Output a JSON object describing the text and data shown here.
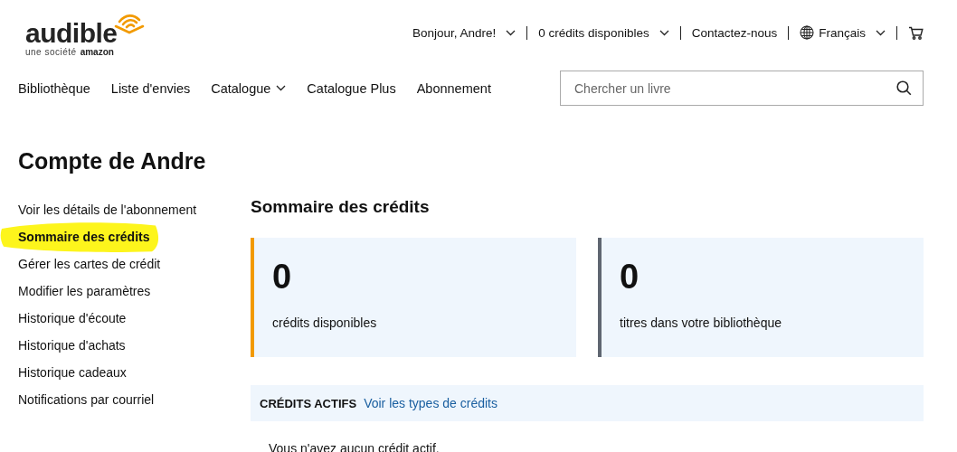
{
  "logo": {
    "wordmark": "audible",
    "tagline": "une société",
    "brand": "amazon"
  },
  "utility_nav": [
    {
      "kind": "menu",
      "label": "Bonjour, Andre!",
      "dropdown": true
    },
    {
      "kind": "menu",
      "label": "0 crédits disponibles",
      "dropdown": true
    },
    {
      "kind": "link",
      "label": "Contactez-nous",
      "dropdown": false
    },
    {
      "kind": "language",
      "label": "Français",
      "dropdown": true
    },
    {
      "kind": "cart",
      "dropdown": false
    }
  ],
  "main_nav": [
    {
      "label": "Bibliothèque",
      "dropdown": false
    },
    {
      "label": "Liste d'envies",
      "dropdown": false
    },
    {
      "label": "Catalogue",
      "dropdown": true
    },
    {
      "label": "Catalogue Plus",
      "dropdown": false
    },
    {
      "label": "Abonnement",
      "dropdown": false
    }
  ],
  "search": {
    "placeholder": "Chercher un livre"
  },
  "page_title": "Compte de Andre",
  "sidebar": [
    {
      "label": "Voir les détails de l'abonnement",
      "selected": false
    },
    {
      "label": "Sommaire des crédits",
      "selected": true
    },
    {
      "label": "Gérer les cartes de crédit",
      "selected": false
    },
    {
      "label": "Modifier les paramètres",
      "selected": false
    },
    {
      "label": "Historique d'écoute",
      "selected": false
    },
    {
      "label": "Historique d'achats",
      "selected": false
    },
    {
      "label": "Historique cadeaux",
      "selected": false
    },
    {
      "label": "Notifications par courriel",
      "selected": false
    }
  ],
  "section_title": "Sommaire des crédits",
  "stats": [
    {
      "value": "0",
      "label": "crédits disponibles",
      "color": "#f29a00"
    },
    {
      "value": "0",
      "label": "titres dans votre bibliothèque",
      "color": "#5f6671"
    }
  ],
  "active_credits": {
    "heading": "CRÉDITS ACTIFS",
    "link": "Voir les types de crédits",
    "message": "Vous n'avez aucun crédit actif."
  }
}
